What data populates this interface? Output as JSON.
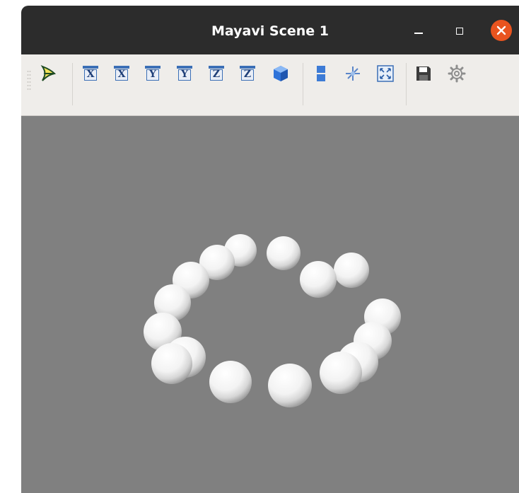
{
  "window": {
    "title": "Mayavi Scene 1"
  },
  "toolbar": {
    "buttons": [
      {
        "icon": "mayavi-logo-icon"
      },
      {
        "icon": "view-x-plus-icon",
        "label": "X"
      },
      {
        "icon": "view-x-minus-icon",
        "label": "X"
      },
      {
        "icon": "view-y-plus-icon",
        "label": "Y"
      },
      {
        "icon": "view-y-minus-icon",
        "label": "Y"
      },
      {
        "icon": "view-z-plus-icon",
        "label": "Z"
      },
      {
        "icon": "view-z-minus-icon",
        "label": "Z"
      },
      {
        "icon": "isometric-cube-icon"
      },
      {
        "icon": "parallel-projection-icon"
      },
      {
        "icon": "axes-indicator-icon"
      },
      {
        "icon": "full-screen-icon"
      },
      {
        "icon": "save-icon"
      },
      {
        "icon": "settings-gear-icon"
      }
    ]
  },
  "scene": {
    "background_color": "#808080",
    "sphere_count": 16,
    "object": "ring of spheres"
  }
}
